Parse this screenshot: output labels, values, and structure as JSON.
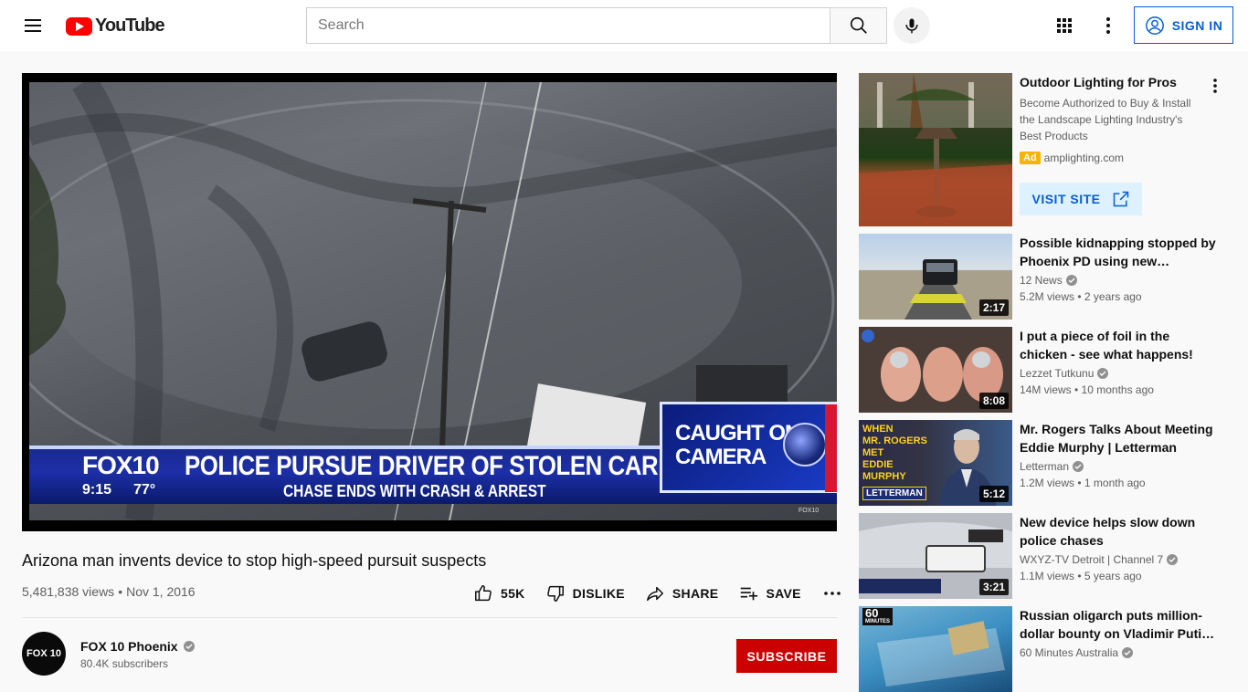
{
  "header": {
    "logo_text": "YouTube",
    "search_placeholder": "Search",
    "sign_in_label": "SIGN IN"
  },
  "player": {
    "overlay": {
      "channel_logo": "FOX10",
      "time": "9:15",
      "temp": "77°",
      "headline": "POLICE PURSUE DRIVER OF STOLEN CAR",
      "subhead": "CHASE ENDS WITH CRASH & ARREST",
      "badge_line1": "CAUGHT ON",
      "badge_line2": "CAMERA",
      "watermark": "FOX10"
    }
  },
  "video": {
    "title": "Arizona man invents device to stop high-speed pursuit suspects",
    "views": "5,481,838 views",
    "separator": "•",
    "date": "Nov 1, 2016",
    "actions": {
      "like_label": "55K",
      "dislike_label": "DISLIKE",
      "share_label": "SHARE",
      "save_label": "SAVE"
    }
  },
  "channel": {
    "name": "FOX 10 Phoenix",
    "subscribers": "80.4K subscribers",
    "avatar_text": "FOX 10",
    "subscribe_label": "SUBSCRIBE"
  },
  "sidebar": {
    "ad": {
      "title": "Outdoor Lighting for Pros",
      "description": "Become Authorized to Buy & Install the Landscape Lighting Industry's Best Products",
      "badge": "Ad",
      "domain": "amplighting.com",
      "cta": "VISIT SITE"
    },
    "recommendations": [
      {
        "title": "Possible kidnapping stopped by Phoenix PD using new…",
        "channel": "12 News",
        "verified": true,
        "stats": "5.2M views • 2 years ago",
        "duration": "2:17"
      },
      {
        "title": "I put a piece of foil in the chicken - see what happens!",
        "channel": "Lezzet Tutkunu",
        "verified": true,
        "stats": "14M views • 10 months ago",
        "duration": "8:08"
      },
      {
        "title": "Mr. Rogers Talks About Meeting Eddie Murphy | Letterman",
        "channel": "Letterman",
        "verified": true,
        "stats": "1.2M views • 1 month ago",
        "duration": "5:12"
      },
      {
        "title": "New device helps slow down police chases",
        "channel": "WXYZ-TV Detroit | Channel 7",
        "verified": true,
        "stats": "1.1M views • 5 years ago",
        "duration": "3:21"
      },
      {
        "title": "Russian oligarch puts million-dollar bounty on Vladimir Puti…",
        "channel": "60 Minutes Australia",
        "verified": true,
        "stats": "",
        "duration": ""
      }
    ],
    "thumb_text": {
      "rogers": [
        "WHEN",
        "MR. ROGERS",
        "MET",
        "EDDIE",
        "MURPHY"
      ],
      "letterman": "LETTERMAN",
      "sixty": "60",
      "minutes": "MINUTES"
    }
  },
  "colors": {
    "brand_red": "#ff0000",
    "link_blue": "#065fd4",
    "subscribe_red": "#cc0000",
    "ad_yellow": "#f4b400"
  }
}
